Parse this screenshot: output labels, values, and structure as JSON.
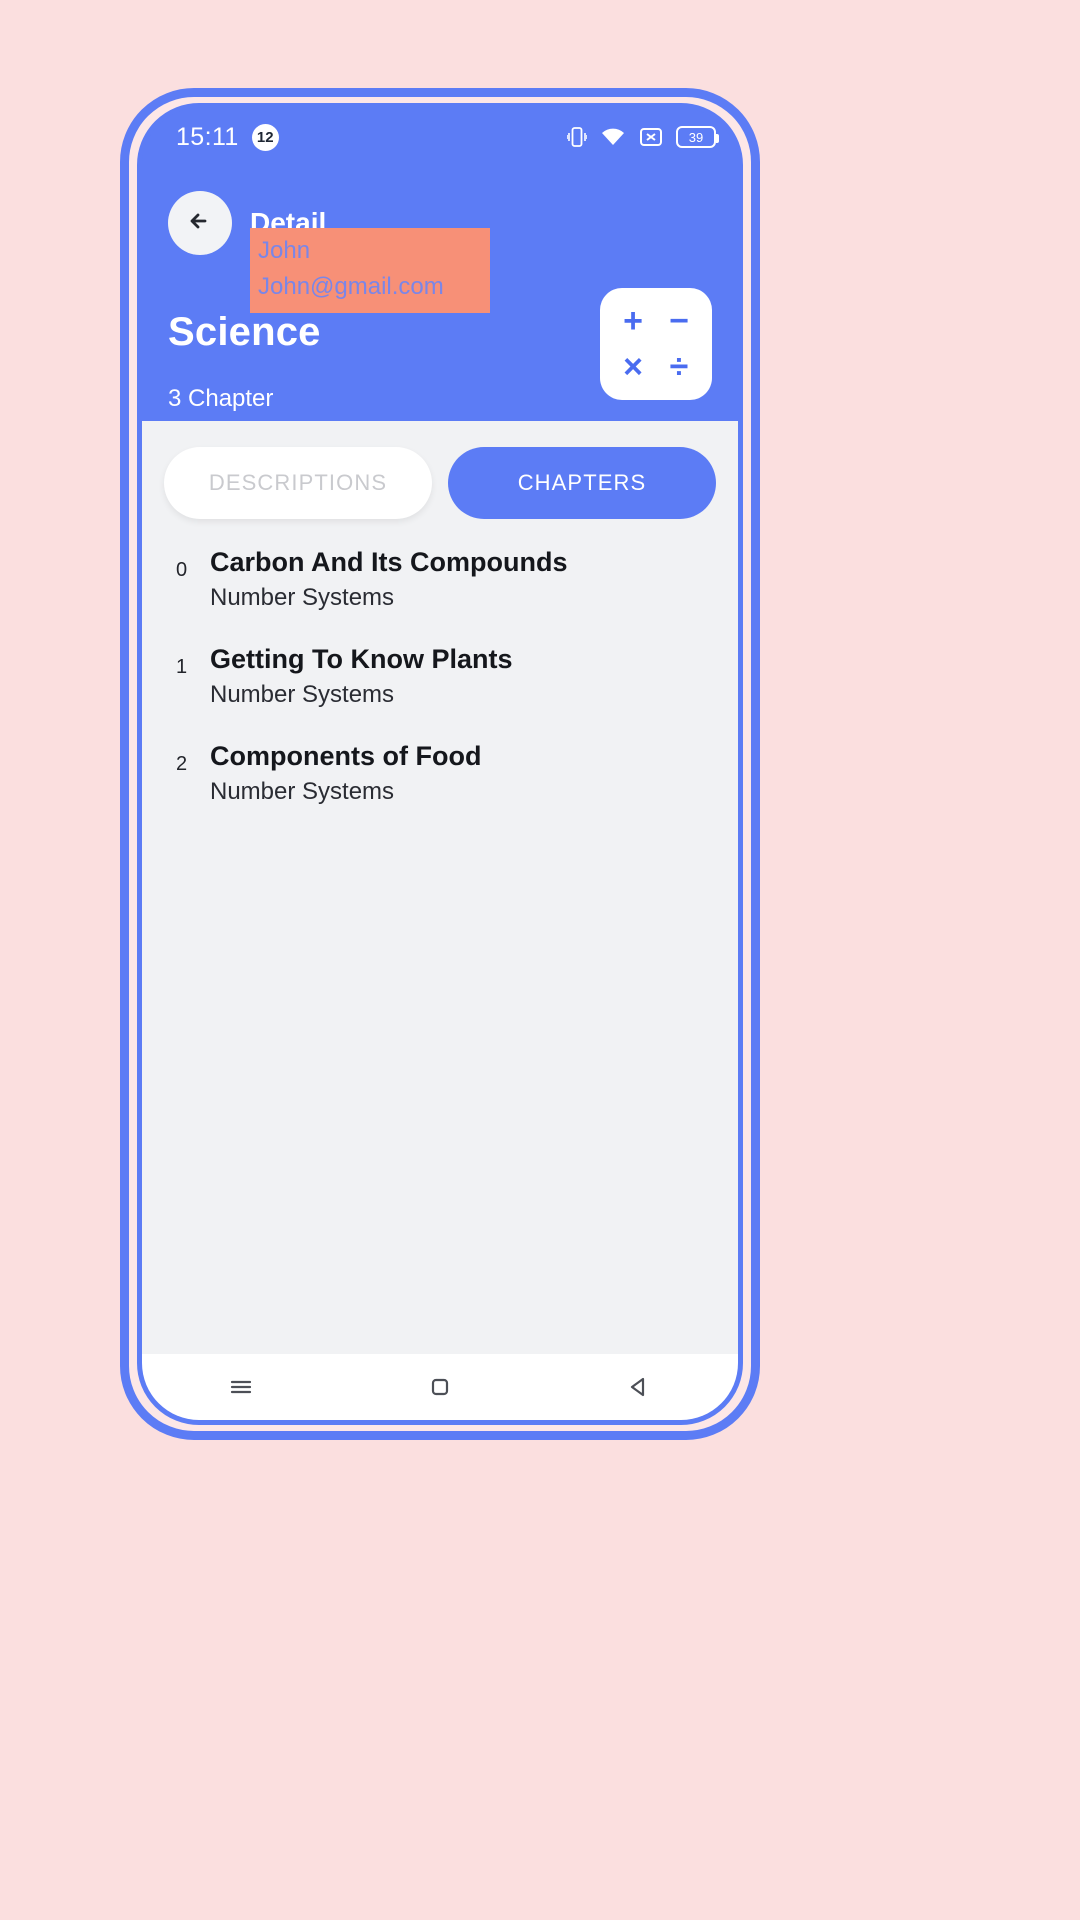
{
  "status_bar": {
    "time": "15:11",
    "notification_count": "12",
    "battery_level": "39",
    "icons": [
      "vibrate-icon",
      "wifi-icon",
      "no-sim-icon",
      "battery-icon"
    ]
  },
  "header": {
    "back_icon": "arrow-left-icon",
    "app_title": "Detail",
    "overlay": {
      "user_name": "John",
      "user_email": "John@gmail.com"
    },
    "subject_title": "Science",
    "chapter_count": "3 Chapter",
    "subject_icon_symbols": [
      "+",
      "−",
      "×",
      "÷"
    ]
  },
  "tabs": [
    {
      "label": "DESCRIPTIONS",
      "active": false
    },
    {
      "label": "CHAPTERS",
      "active": true
    }
  ],
  "chapters": [
    {
      "index": "0",
      "title": "Carbon And Its Compounds",
      "subtitle": "Number Systems"
    },
    {
      "index": "1",
      "title": "Getting To Know Plants",
      "subtitle": "Number Systems"
    },
    {
      "index": "2",
      "title": "Components of Food",
      "subtitle": "Number Systems"
    }
  ],
  "nav_bar": {
    "menu_icon": "menu-icon",
    "home_icon": "square-home-icon",
    "back_icon": "triangle-back-icon"
  },
  "colors": {
    "page_background": "#fbdfdf",
    "brand_blue": "#5c7cf5",
    "sheet_background": "#f1f2f4",
    "overlay_orange": "#f79077",
    "overlay_text": "#7a86e8"
  }
}
